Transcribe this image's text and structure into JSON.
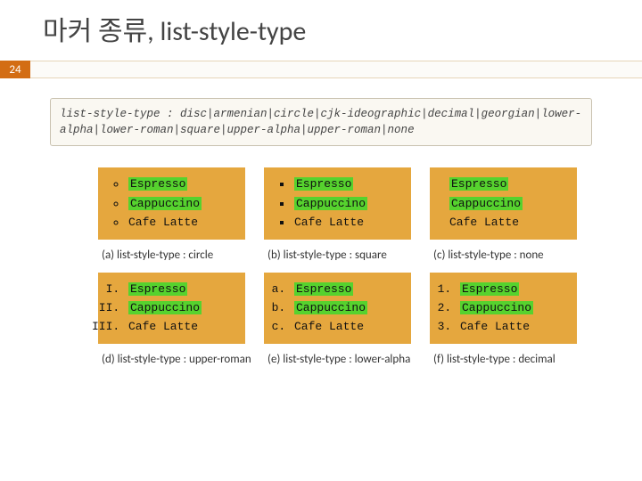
{
  "header": {
    "title": "마커 종류, list-style-type",
    "page_number": "24"
  },
  "syntax": "list-style-type : disc|armenian|circle|cjk-ideographic|decimal|georgian|lower-alpha|lower-roman|square|upper-alpha|upper-roman|none",
  "items": {
    "espresso": "Espresso",
    "cappuccino": "Cappuccino",
    "cafelatte": "Cafe Latte"
  },
  "captions": {
    "a": "(a) list-style-type : circle",
    "b": "(b) list-style-type : square",
    "c": "(c) list-style-type : none",
    "d": "(d) list-style-type : upper-roman",
    "e": "(e) list-style-type : lower-alpha",
    "f": "(f) list-style-type : decimal"
  }
}
